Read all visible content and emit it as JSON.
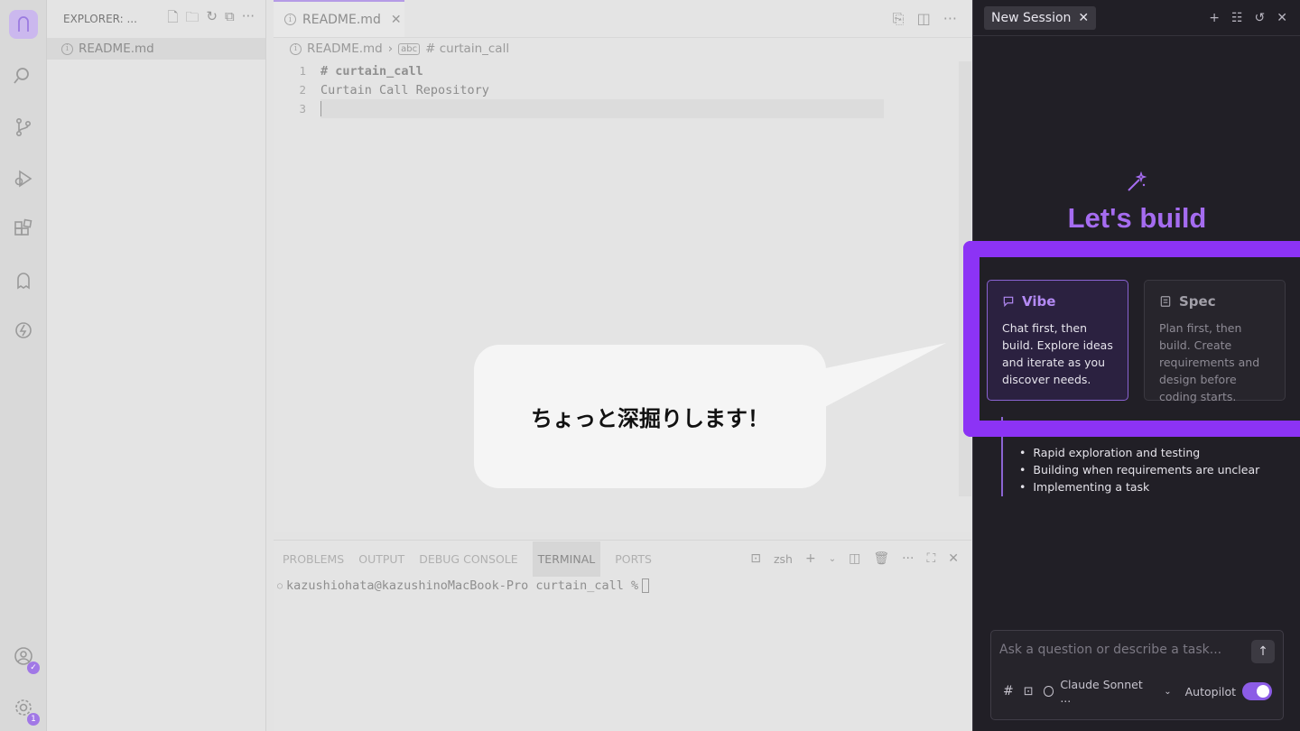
{
  "activity_bar": {
    "icons": [
      "kiro-logo-icon",
      "search-icon",
      "source-control-icon",
      "run-debug-icon",
      "extensions-icon",
      "kiro-ghost-icon",
      "specs-icon",
      "account-icon",
      "settings-gear-icon"
    ],
    "settings_badge": "1"
  },
  "sidebar": {
    "title": "EXPLORER: ...",
    "files": [
      {
        "name": "README.md"
      }
    ]
  },
  "editor": {
    "tab_label": "README.md",
    "breadcrumb": {
      "file": "README.md",
      "symbol": "# curtain_call"
    },
    "lines": [
      {
        "num": "1",
        "text": "# curtain_call"
      },
      {
        "num": "2",
        "text": "Curtain Call Repository"
      },
      {
        "num": "3",
        "text": ""
      }
    ]
  },
  "panel": {
    "tabs": [
      "PROBLEMS",
      "OUTPUT",
      "DEBUG CONSOLE",
      "TERMINAL",
      "PORTS"
    ],
    "active_tab": "TERMINAL",
    "shell": "zsh",
    "prompt": "kazushiohata@kazushinoMacBook-Pro curtain_call %"
  },
  "chat": {
    "session_tab": "New Session",
    "heading": "Let's build",
    "modes": {
      "vibe": {
        "title": "Vibe",
        "description": "Chat first, then build. Explore ideas and iterate as you discover needs."
      },
      "spec": {
        "title": "Spec",
        "description": "Plan first, then build. Create requirements and design before coding starts."
      }
    },
    "bullets": [
      "Rapid exploration and testing",
      "Building when requirements are unclear",
      "Implementing a task"
    ],
    "composer": {
      "placeholder": "Ask a question or describe a task...",
      "model": "Claude Sonnet ...",
      "autopilot_label": "Autopilot",
      "autopilot_on": true
    },
    "accent_color": "#a56cf0"
  },
  "overlay": {
    "bubble_text": "ちょっと深掘りします！",
    "highlight_color": "#8c33f5"
  }
}
